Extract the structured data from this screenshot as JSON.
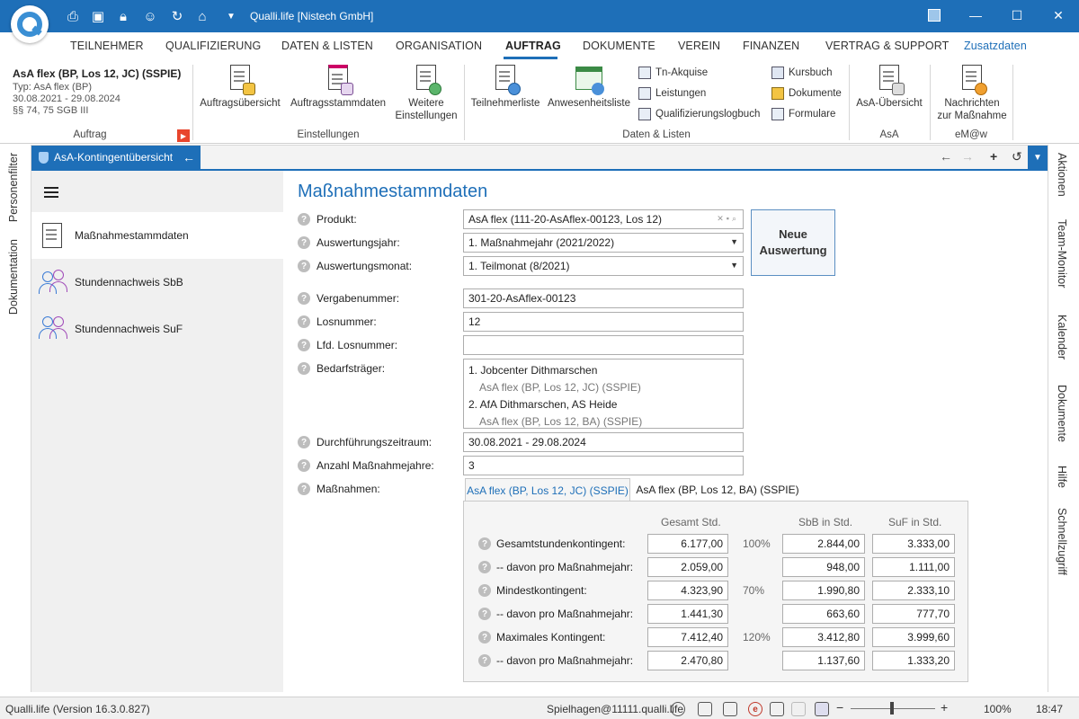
{
  "window": {
    "title": "Qualli.life [Nistech GmbH]"
  },
  "menu": {
    "items": [
      "TEILNEHMER",
      "QUALIFIZIERUNG",
      "DATEN & LISTEN",
      "ORGANISATION",
      "AUFTRAG",
      "DOKUMENTE",
      "VEREIN",
      "FINANZEN",
      "VERTRAG & SUPPORT",
      "Zusatzdaten"
    ],
    "active": "AUFTRAG"
  },
  "ribbon": {
    "context": {
      "title": "AsA flex (BP, Los 12, JC) (SSPIE)",
      "type": "Typ: AsA flex (BP)",
      "period": "30.08.2021 - 29.08.2024",
      "law": "§§ 74, 75 SGB III"
    },
    "groups": {
      "auftrag": "Auftrag",
      "einstellungen": "Einstellungen",
      "daten": "Daten & Listen",
      "asa": "AsA",
      "emaw": "eM@w"
    },
    "buttons": {
      "auftragsuebersicht": "Auftragsübersicht",
      "auftragsstammdaten": "Auftragsstammdaten",
      "weitere_1": "Weitere",
      "weitere_2": "Einstellungen",
      "teilnehmerliste": "Teilnehmerliste",
      "anwesenheitsliste": "Anwesenheitsliste",
      "tn_akquise": "Tn-Akquise",
      "leistungen": "Leistungen",
      "qualifizierungslogbuch": "Qualifizierungslogbuch",
      "kursbuch": "Kursbuch",
      "dokumente": "Dokumente",
      "formulare": "Formulare",
      "asa_uebersicht": "AsA-Übersicht",
      "nachrichten_1": "Nachrichten",
      "nachrichten_2": "zur Maßnahme"
    }
  },
  "side_left": [
    "Personenfilter",
    "Dokumentation"
  ],
  "side_right": [
    "Aktionen",
    "Team-Monitor",
    "Kalender",
    "Dokumente",
    "Hilfe",
    "Schnellzugriff"
  ],
  "doc_tab": "AsA-Kontingentübersicht",
  "nav": {
    "items": [
      "Maßnahmestammdaten",
      "Stundennachweis SbB",
      "Stundennachweis SuF"
    ]
  },
  "form": {
    "heading": "Maßnahmestammdaten",
    "produkt_label": "Produkt:",
    "produkt_value": "AsA flex (111-20-AsAflex-00123, Los 12)",
    "jahr_label": "Auswertungsjahr:",
    "jahr_value": "1. Maßnahmejahr (2021/2022)",
    "monat_label": "Auswertungsmonat:",
    "monat_value": "1. Teilmonat (8/2021)",
    "neue_1": "Neue",
    "neue_2": "Auswertung",
    "vergabe_label": "Vergabenummer:",
    "vergabe_value": "301-20-AsAflex-00123",
    "los_label": "Losnummer:",
    "los_value": "12",
    "lfd_label": "Lfd. Losnummer:",
    "lfd_value": "",
    "bedarf_label": "Bedarfsträger:",
    "bedarf": [
      {
        "name": "1. Jobcenter Dithmarschen",
        "sub": "AsA flex (BP, Los 12, JC) (SSPIE)"
      },
      {
        "name": "2. AfA Dithmarschen, AS Heide",
        "sub": "AsA flex (BP, Los 12, BA) (SSPIE)"
      }
    ],
    "zeitraum_label": "Durchführungszeitraum:",
    "zeitraum_value": "30.08.2021 - 29.08.2024",
    "jahre_label": "Anzahl Maßnahmejahre:",
    "jahre_value": "3",
    "massnahmen_label": "Maßnahmen:"
  },
  "tabs": [
    "AsA flex (BP, Los 12, JC) (SSPIE)",
    "AsA flex (BP, Los 12, BA) (SSPIE)"
  ],
  "table": {
    "headers": [
      "Gesamt Std.",
      "SbB in Std.",
      "SuF in Std."
    ],
    "rows": [
      {
        "label": "Gesamtstundenkontingent:",
        "gesamt": "6.177,00",
        "pct": "100%",
        "sbb": "2.844,00",
        "suf": "3.333,00"
      },
      {
        "label": "-- davon pro Maßnahmejahr:",
        "gesamt": "2.059,00",
        "pct": "",
        "sbb": "948,00",
        "suf": "1.111,00"
      },
      {
        "label": "Mindestkontingent:",
        "gesamt": "4.323,90",
        "pct": "70%",
        "sbb": "1.990,80",
        "suf": "2.333,10"
      },
      {
        "label": "-- davon pro Maßnahmejahr:",
        "gesamt": "1.441,30",
        "pct": "",
        "sbb": "663,60",
        "suf": "777,70"
      },
      {
        "label": "Maximales Kontingent:",
        "gesamt": "7.412,40",
        "pct": "120%",
        "sbb": "3.412,80",
        "suf": "3.999,60"
      },
      {
        "label": "-- davon pro Maßnahmejahr:",
        "gesamt": "2.470,80",
        "pct": "",
        "sbb": "1.137,60",
        "suf": "1.333,20"
      }
    ]
  },
  "status": {
    "version": "Qualli.life (Version 16.3.0.827)",
    "user": "Spielhagen@11111.qualli.life",
    "zoom": "100%",
    "time": "18:47"
  },
  "colors": {
    "accent": "#1e6fb8"
  }
}
